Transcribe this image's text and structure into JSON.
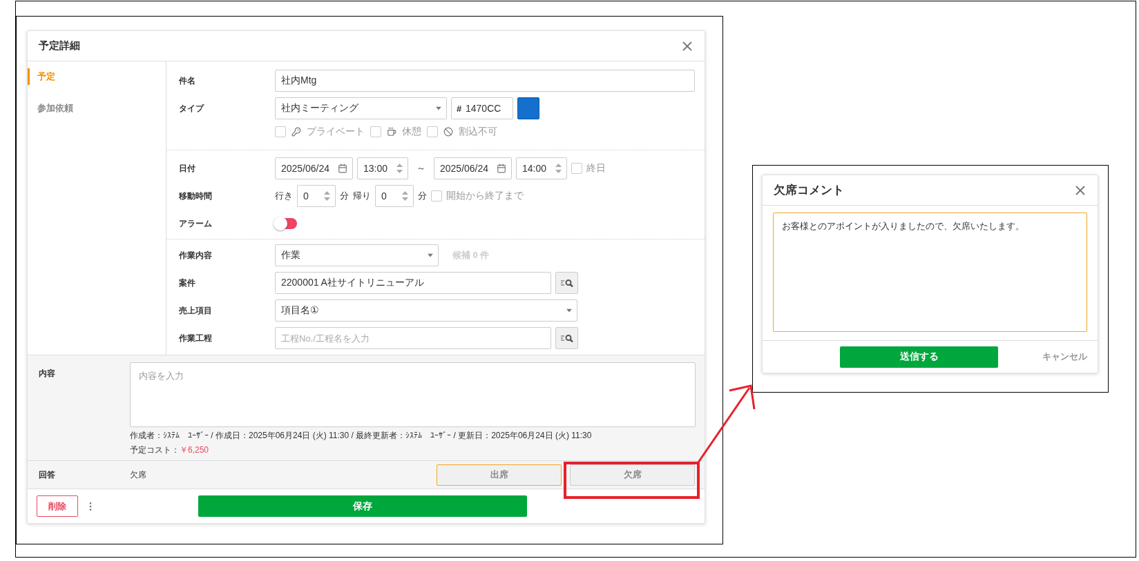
{
  "dialog": {
    "title": "予定詳細"
  },
  "nav": [
    {
      "label": "予定",
      "selected": true
    },
    {
      "label": "参加依頼",
      "selected": false
    }
  ],
  "form": {
    "subject": {
      "label": "件名",
      "value": "社内Mtg"
    },
    "type": {
      "label": "タイプ",
      "value": "社内ミーティング",
      "color_prefix": "#",
      "color_value": "1470CC",
      "options": [
        {
          "kind": "key",
          "label": "プライベート",
          "checked": false
        },
        {
          "kind": "cup",
          "label": "休憩",
          "checked": false
        },
        {
          "kind": "ban",
          "label": "割込不可",
          "checked": false
        }
      ]
    },
    "date": {
      "label": "日付",
      "start_date": "2025/06/24",
      "start_time": "13:00",
      "separator": "～",
      "end_date": "2025/06/24",
      "end_time": "14:00",
      "all_day": {
        "label": "終日",
        "checked": false
      }
    },
    "travel": {
      "label": "移動時間",
      "go_label": "行き",
      "go_value": "0",
      "go_unit": "分",
      "return_label": "帰り",
      "return_value": "0",
      "return_unit": "分",
      "span": {
        "label": "開始から終了まで",
        "checked": false
      }
    },
    "alarm": {
      "label": "アラーム",
      "on": false
    },
    "task": {
      "label": "作業内容",
      "value": "作業",
      "hint": "候補 0 件"
    },
    "project": {
      "label": "案件",
      "value": "2200001 A社サイトリニューアル"
    },
    "sales_item": {
      "label": "売上項目",
      "value": "項目名①"
    },
    "process": {
      "label": "作業工程",
      "placeholder": "工程No./工程名を入力"
    }
  },
  "content": {
    "label": "内容",
    "placeholder": "内容を入力",
    "meta": "作成者：ｼｽﾃﾑ　ﾕｰｻﾞｰ / 作成日：2025年06月24日 (火) 11:30 / 最終更新者：ｼｽﾃﾑ　ﾕｰｻﾞｰ / 更新日：2025年06月24日 (火) 11:30",
    "cost_label": "予定コスト：",
    "cost_value": "￥6,250"
  },
  "reply": {
    "label": "回答",
    "value": "欠席",
    "buttons": [
      {
        "label": "出席",
        "focused": true
      },
      {
        "label": "欠席",
        "focused": false
      }
    ]
  },
  "footer": {
    "delete": "削除",
    "save": "保存"
  },
  "comment_dialog": {
    "title": "欠席コメント",
    "value": "お客様とのアポイントが入りましたので、欠席いたします。",
    "submit": "送信する",
    "cancel": "キャンセル"
  }
}
